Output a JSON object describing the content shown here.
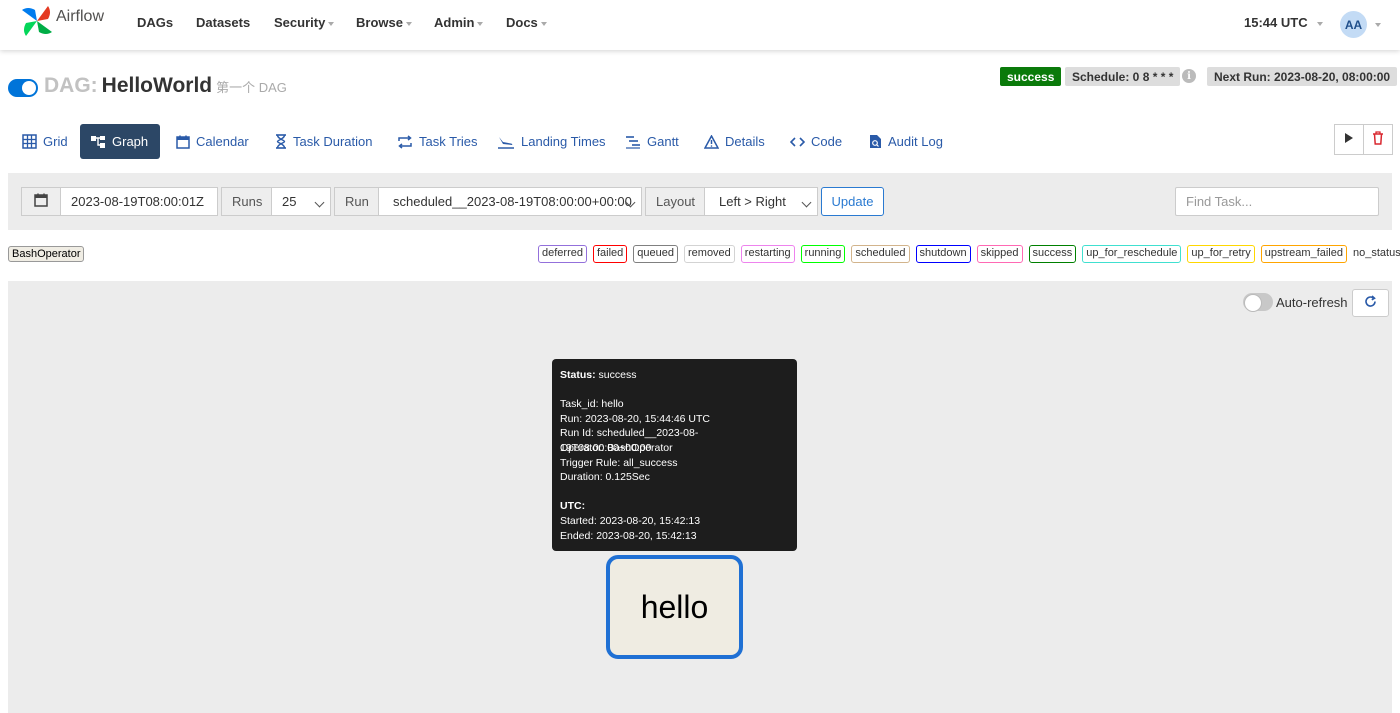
{
  "app": {
    "name": "Airflow"
  },
  "nav": {
    "items": [
      {
        "label": "DAGs"
      },
      {
        "label": "Datasets"
      },
      {
        "label": "Security"
      },
      {
        "label": "Browse"
      },
      {
        "label": "Admin"
      },
      {
        "label": "Docs"
      }
    ],
    "time": "15:44 UTC",
    "avatar": "AA"
  },
  "dag": {
    "prefix": "DAG:",
    "name": "HelloWorld",
    "description": "第一个 DAG",
    "status": "success",
    "schedule": "Schedule: 0 8 * * *",
    "next_run": "Next Run: 2023-08-20, 08:00:00",
    "enabled": true
  },
  "tabs": [
    {
      "label": "Grid",
      "icon": "grid-icon"
    },
    {
      "label": "Graph",
      "icon": "graph-icon",
      "active": true
    },
    {
      "label": "Calendar",
      "icon": "calendar-icon"
    },
    {
      "label": "Task Duration",
      "icon": "hourglass-icon"
    },
    {
      "label": "Task Tries",
      "icon": "retry-icon"
    },
    {
      "label": "Landing Times",
      "icon": "landing-icon"
    },
    {
      "label": "Gantt",
      "icon": "gantt-icon"
    },
    {
      "label": "Details",
      "icon": "warning-icon"
    },
    {
      "label": "Code",
      "icon": "code-icon"
    },
    {
      "label": "Audit Log",
      "icon": "audit-log-icon"
    }
  ],
  "filters": {
    "date": "2023-08-19T08:00:01Z",
    "runs_label": "Runs",
    "runs_value": "25",
    "run_label": "Run",
    "run_value": "scheduled__2023-08-19T08:00:00+00:00",
    "layout_label": "Layout",
    "layout_value": "Left > Right",
    "update": "Update",
    "find_placeholder": "Find Task..."
  },
  "operator_chip": "BashOperator",
  "legend": {
    "states": [
      {
        "label": "deferred",
        "color": "#9370db"
      },
      {
        "label": "failed",
        "color": "#ff0000"
      },
      {
        "label": "queued",
        "color": "#808080"
      },
      {
        "label": "removed",
        "color": "#d3d3d3"
      },
      {
        "label": "restarting",
        "color": "#ee82ee"
      },
      {
        "label": "running",
        "color": "#00ff00"
      },
      {
        "label": "scheduled",
        "color": "#d2b48c"
      },
      {
        "label": "shutdown",
        "color": "#0000ff"
      },
      {
        "label": "skipped",
        "color": "#ff69b4"
      },
      {
        "label": "success",
        "color": "#008000"
      },
      {
        "label": "up_for_reschedule",
        "color": "#40e0d0"
      },
      {
        "label": "up_for_retry",
        "color": "#ffd700"
      },
      {
        "label": "upstream_failed",
        "color": "#ffa500"
      }
    ],
    "no_status": "no_status"
  },
  "graph": {
    "auto_refresh": "Auto-refresh",
    "auto_refresh_on": false,
    "task": {
      "label": "hello",
      "status_color": "#1f70d4"
    }
  },
  "tooltip": {
    "status_label": "Status:",
    "status_value": "success",
    "task_id": "Task_id: hello",
    "run": "Run: 2023-08-20, 15:44:46 UTC",
    "run_id": "Run Id: scheduled__2023-08-19T08:00:00+00:00",
    "operator": "Operator: BashOperator",
    "trigger_rule": "Trigger Rule: all_success",
    "duration": "Duration: 0.125Sec",
    "utc_label": "UTC:",
    "started": "Started: 2023-08-20, 15:42:13",
    "ended": "Ended: 2023-08-20, 15:42:13"
  },
  "colors": {
    "accent": "#2a5aa8",
    "active_tab": "#2c4766",
    "success": "#0a7a0a"
  }
}
